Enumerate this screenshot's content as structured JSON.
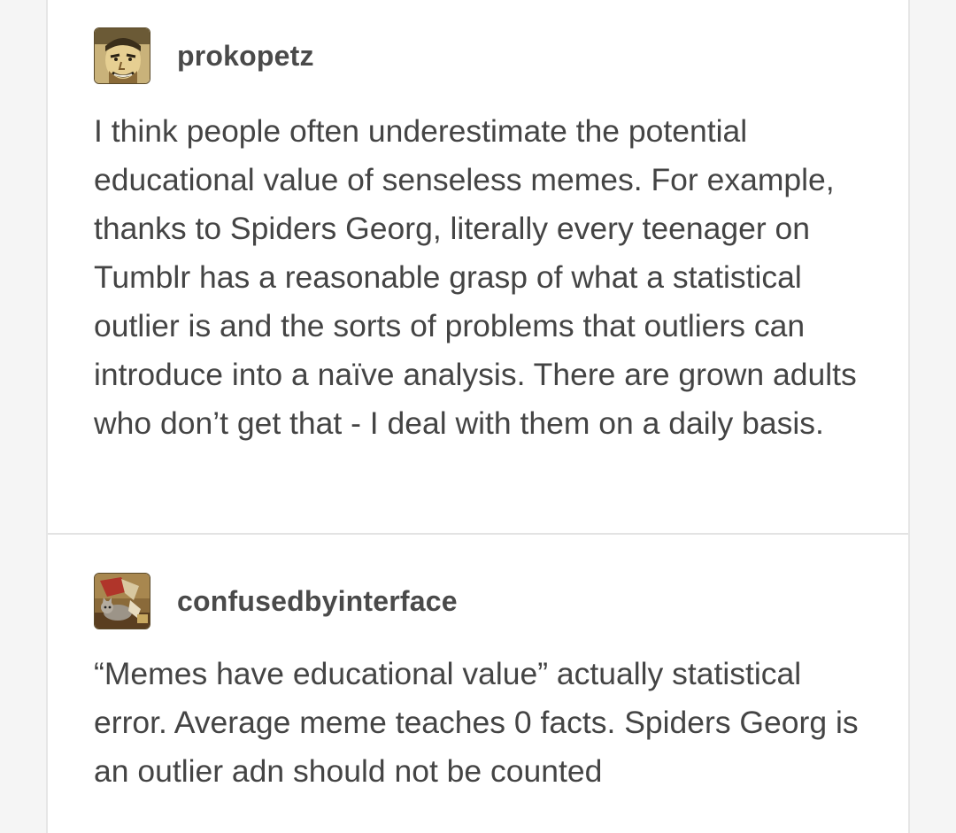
{
  "posts": [
    {
      "username": "prokopetz",
      "avatar_icon": "comic-portrait-avatar",
      "text": "I think people often underestimate the potential educational value of senseless memes. For example, thanks to Spiders Georg, literally every teenager on Tumblr has a reasonable grasp of what a statistical outlier is and the sorts of problems that outliers can introduce into a naïve analysis. There are grown adults who don’t get that - I deal with them on a daily basis."
    },
    {
      "username": "confusedbyinterface",
      "avatar_icon": "cat-illustration-avatar",
      "text": "“Memes have educational value” actually statistical error. Average meme teaches 0 facts. Spiders Georg is an outlier adn should not be counted"
    }
  ],
  "colors": {
    "background": "#f5f5f5",
    "card": "#ffffff",
    "text": "#444444",
    "divider": "#e3e3e3"
  }
}
